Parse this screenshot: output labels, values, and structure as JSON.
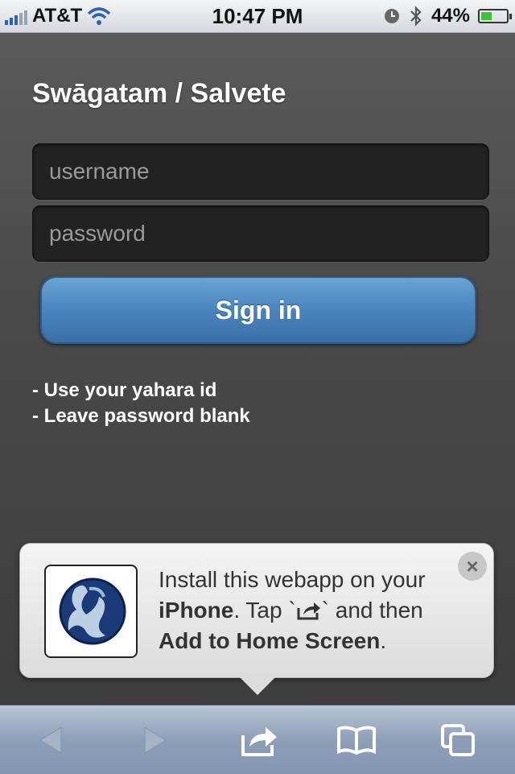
{
  "status_bar": {
    "carrier": "AT&T",
    "time": "10:47 PM",
    "battery": "44%",
    "battery_level": 0.44,
    "icons": [
      "signal-icon",
      "wifi-icon",
      "clock-icon",
      "bluetooth-icon",
      "battery-icon"
    ]
  },
  "login": {
    "title": "Swāgatam / Salvete",
    "username_placeholder": "username",
    "password_placeholder": "password",
    "signin_label": "Sign in",
    "hints": [
      "- Use your yahara id",
      "- Leave password blank"
    ]
  },
  "install_popup": {
    "line1": "Install this webapp on your",
    "device": "iPhone",
    "tap": ". Tap `",
    "after_icon": "` and then",
    "action": "Add to Home Screen",
    "end": ".",
    "close_label": "×",
    "icons": [
      "app-logo-icon",
      "share-icon",
      "close-icon"
    ]
  },
  "toolbar": {
    "icons": [
      "back-icon",
      "forward-icon",
      "share-icon",
      "bookmarks-icon",
      "tabs-icon"
    ]
  },
  "colors": {
    "accent_blue": "#4a84bd",
    "background_gray": "#4a4a4a",
    "toolbar_blue": "#8e9fb8"
  }
}
